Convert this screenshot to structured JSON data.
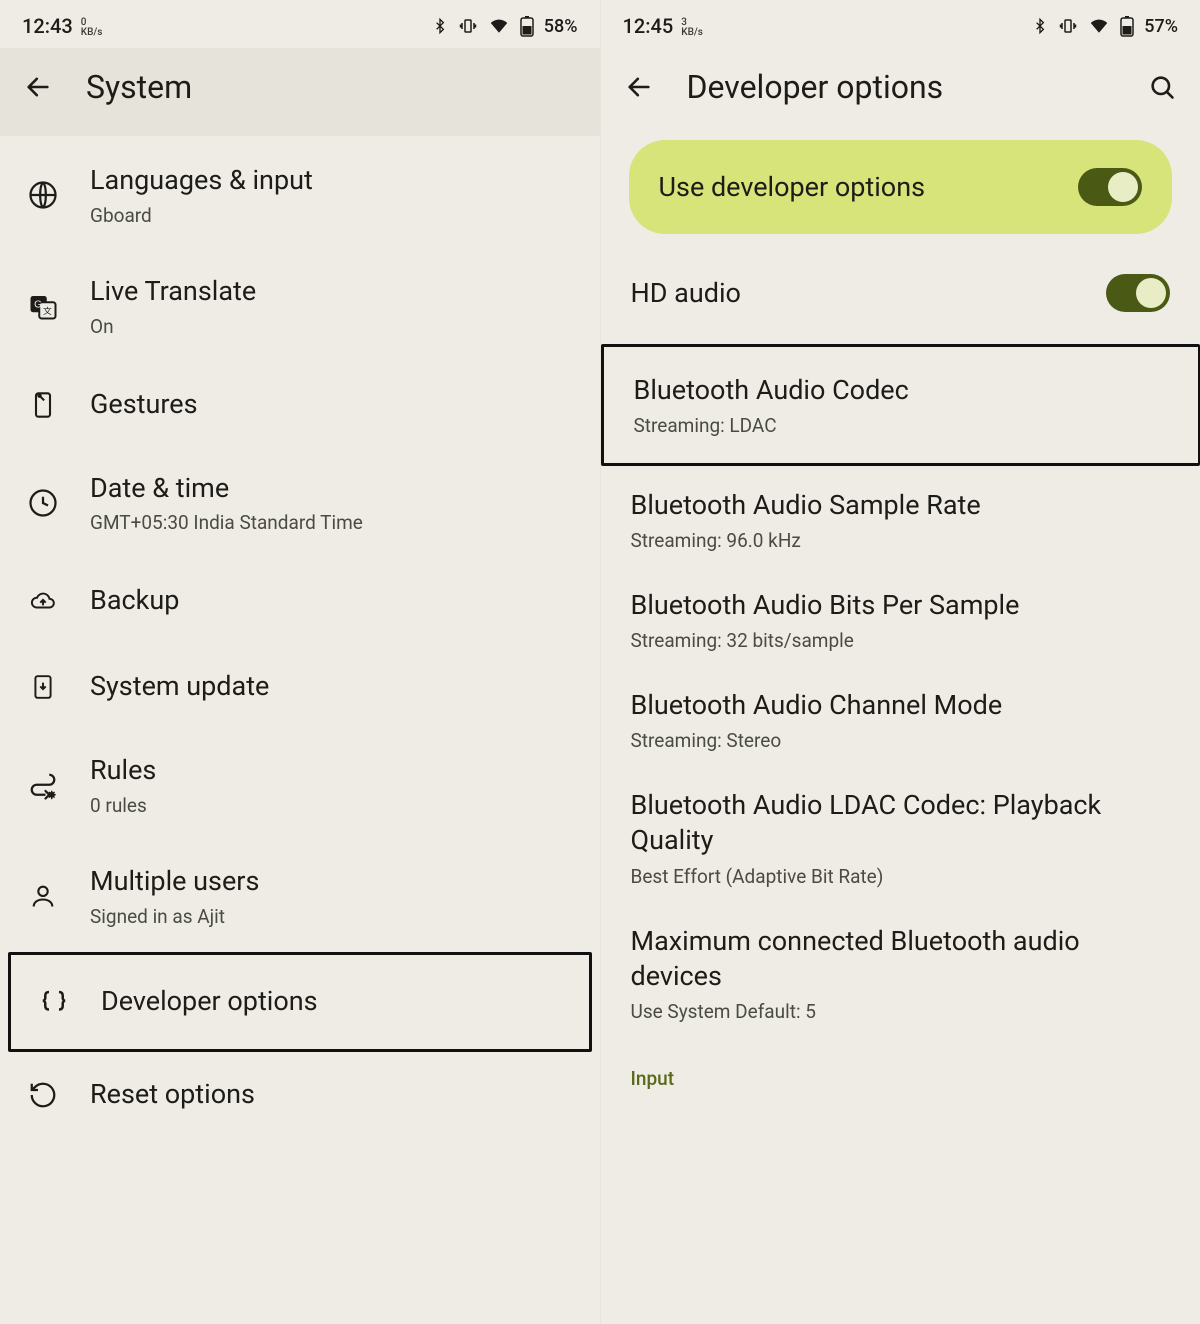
{
  "left": {
    "status": {
      "time": "12:43",
      "kbs_top": "0",
      "kbs_bot": "KB/s",
      "battery": "58%"
    },
    "appbar": {
      "title": "System"
    },
    "rows": [
      {
        "icon": "globe",
        "title": "Languages & input",
        "sub": "Gboard"
      },
      {
        "icon": "translate",
        "title": "Live Translate",
        "sub": "On"
      },
      {
        "icon": "gestures",
        "title": "Gestures",
        "sub": ""
      },
      {
        "icon": "clock",
        "title": "Date & time",
        "sub": "GMT+05:30 India Standard Time"
      },
      {
        "icon": "cloud",
        "title": "Backup",
        "sub": ""
      },
      {
        "icon": "update",
        "title": "System update",
        "sub": ""
      },
      {
        "icon": "rules",
        "title": "Rules",
        "sub": "0 rules"
      },
      {
        "icon": "user",
        "title": "Multiple users",
        "sub": "Signed in as Ajit"
      },
      {
        "icon": "braces",
        "title": "Developer options",
        "sub": ""
      },
      {
        "icon": "reset",
        "title": "Reset options",
        "sub": ""
      }
    ]
  },
  "right": {
    "status": {
      "time": "12:45",
      "kbs_top": "3",
      "kbs_bot": "KB/s",
      "battery": "57%"
    },
    "appbar": {
      "title": "Developer options"
    },
    "toggle": {
      "label": "Use developer options"
    },
    "hd": {
      "title": "HD audio"
    },
    "rows": [
      {
        "title": "Bluetooth Audio Codec",
        "sub": "Streaming: LDAC"
      },
      {
        "title": "Bluetooth Audio Sample Rate",
        "sub": "Streaming: 96.0 kHz"
      },
      {
        "title": "Bluetooth Audio Bits Per Sample",
        "sub": "Streaming: 32 bits/sample"
      },
      {
        "title": "Bluetooth Audio Channel Mode",
        "sub": "Streaming: Stereo"
      },
      {
        "title": "Bluetooth Audio LDAC Codec: Playback Quality",
        "sub": "Best Effort (Adaptive Bit Rate)"
      },
      {
        "title": "Maximum connected Bluetooth audio devices",
        "sub": "Use System Default: 5"
      }
    ],
    "section_label": "Input"
  }
}
